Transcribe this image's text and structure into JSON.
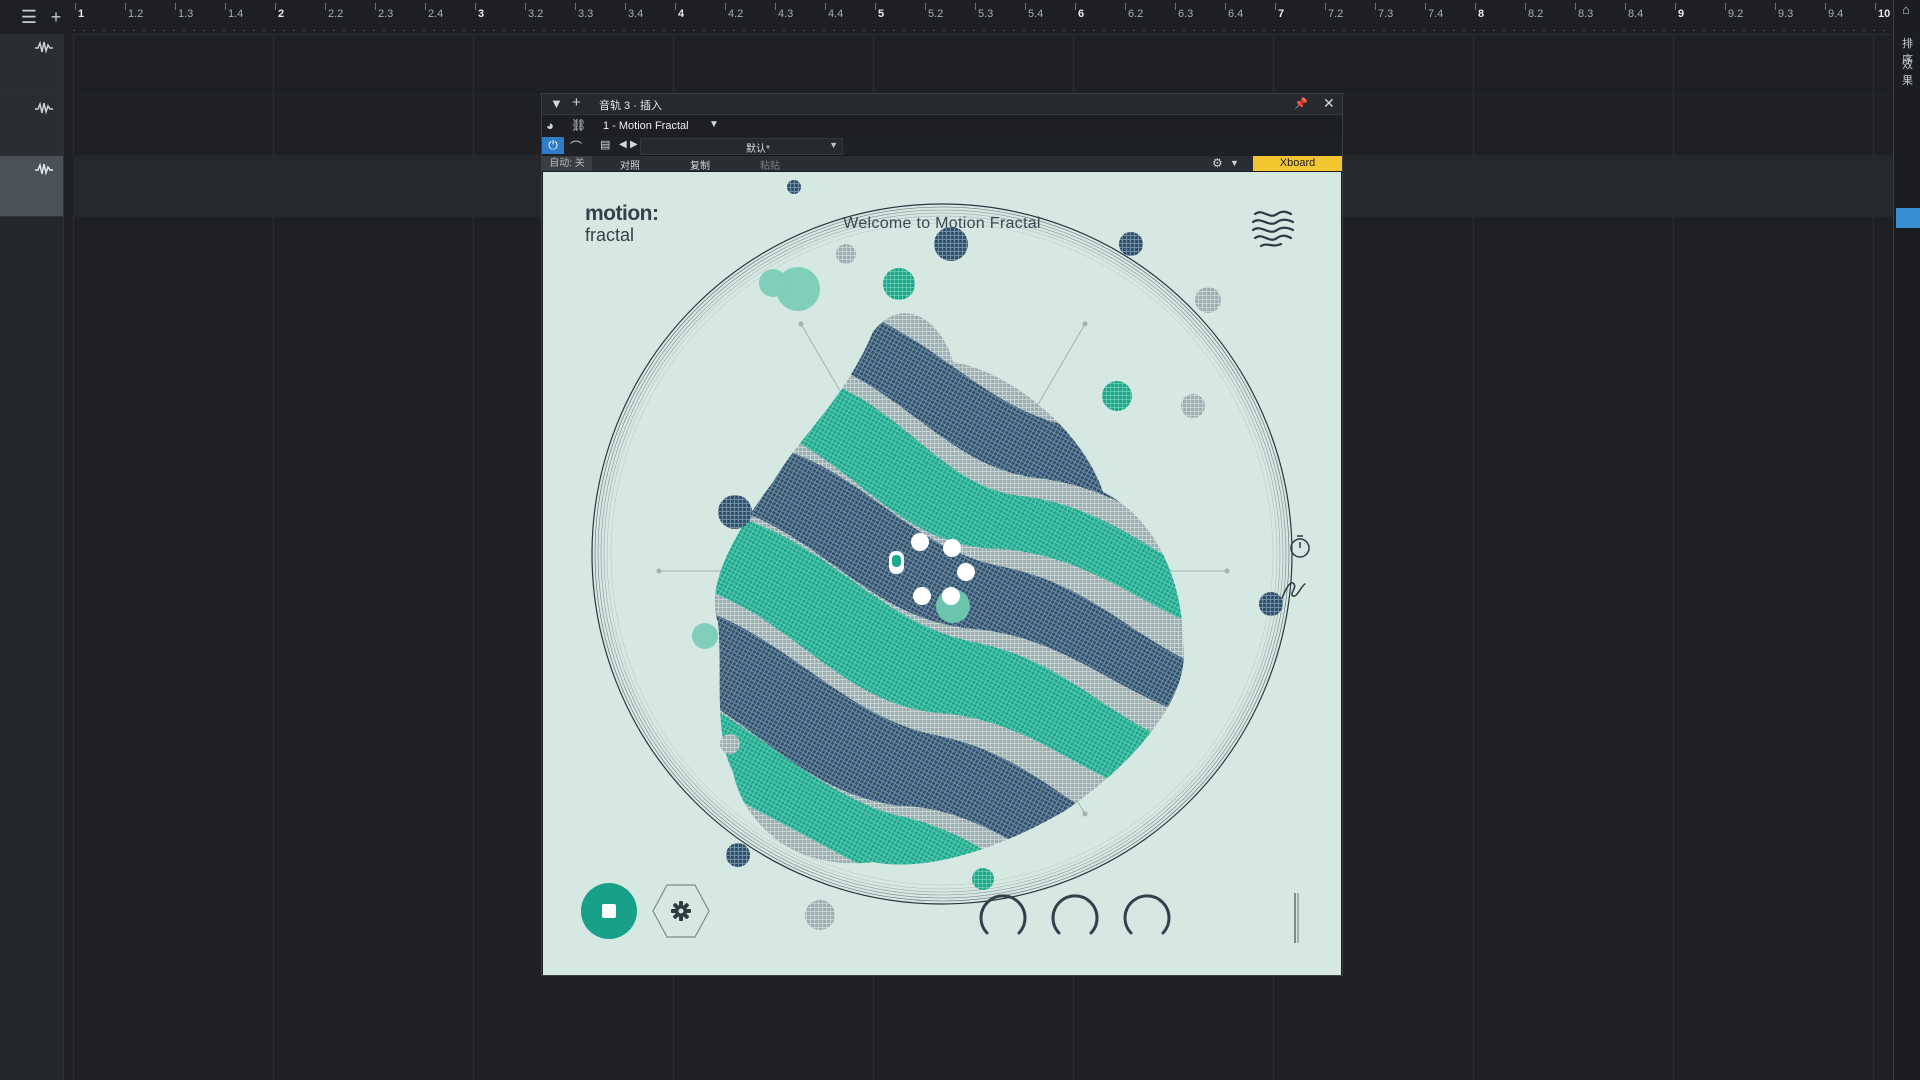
{
  "ruler": {
    "labels": [
      "1",
      "1.2",
      "1.3",
      "1.4",
      "2",
      "2.2",
      "2.3",
      "2.4",
      "3",
      "3.2",
      "3.3",
      "3.4",
      "4",
      "4.2",
      "4.3",
      "4.4",
      "5",
      "5.2",
      "5.3",
      "5.4",
      "6",
      "6.2",
      "6.3",
      "6.4",
      "7",
      "7.2",
      "7.3",
      "7.4",
      "8",
      "8.2",
      "8.3",
      "8.4",
      "9",
      "9.2",
      "9.3",
      "9.4",
      "10"
    ]
  },
  "right_panel": {
    "item1": "排序",
    "item2": "效果"
  },
  "plugin": {
    "title": "音轨 3 · 插入",
    "preset_slot": "1 - Motion Fractal",
    "preset_value": "默认*",
    "automation": "自动: 关",
    "compare": "对照",
    "copy": "复制",
    "paste": "粘贴",
    "xboard": "Xboard"
  },
  "instrument": {
    "brand_line1": "motion:",
    "brand_line2": "fractal",
    "welcome": "Welcome to Motion Fractal",
    "colors": {
      "background": "#d5e8e2",
      "teal": "#19a88e",
      "navy": "#2f4f6c",
      "grey": "#a4b3b7"
    }
  }
}
